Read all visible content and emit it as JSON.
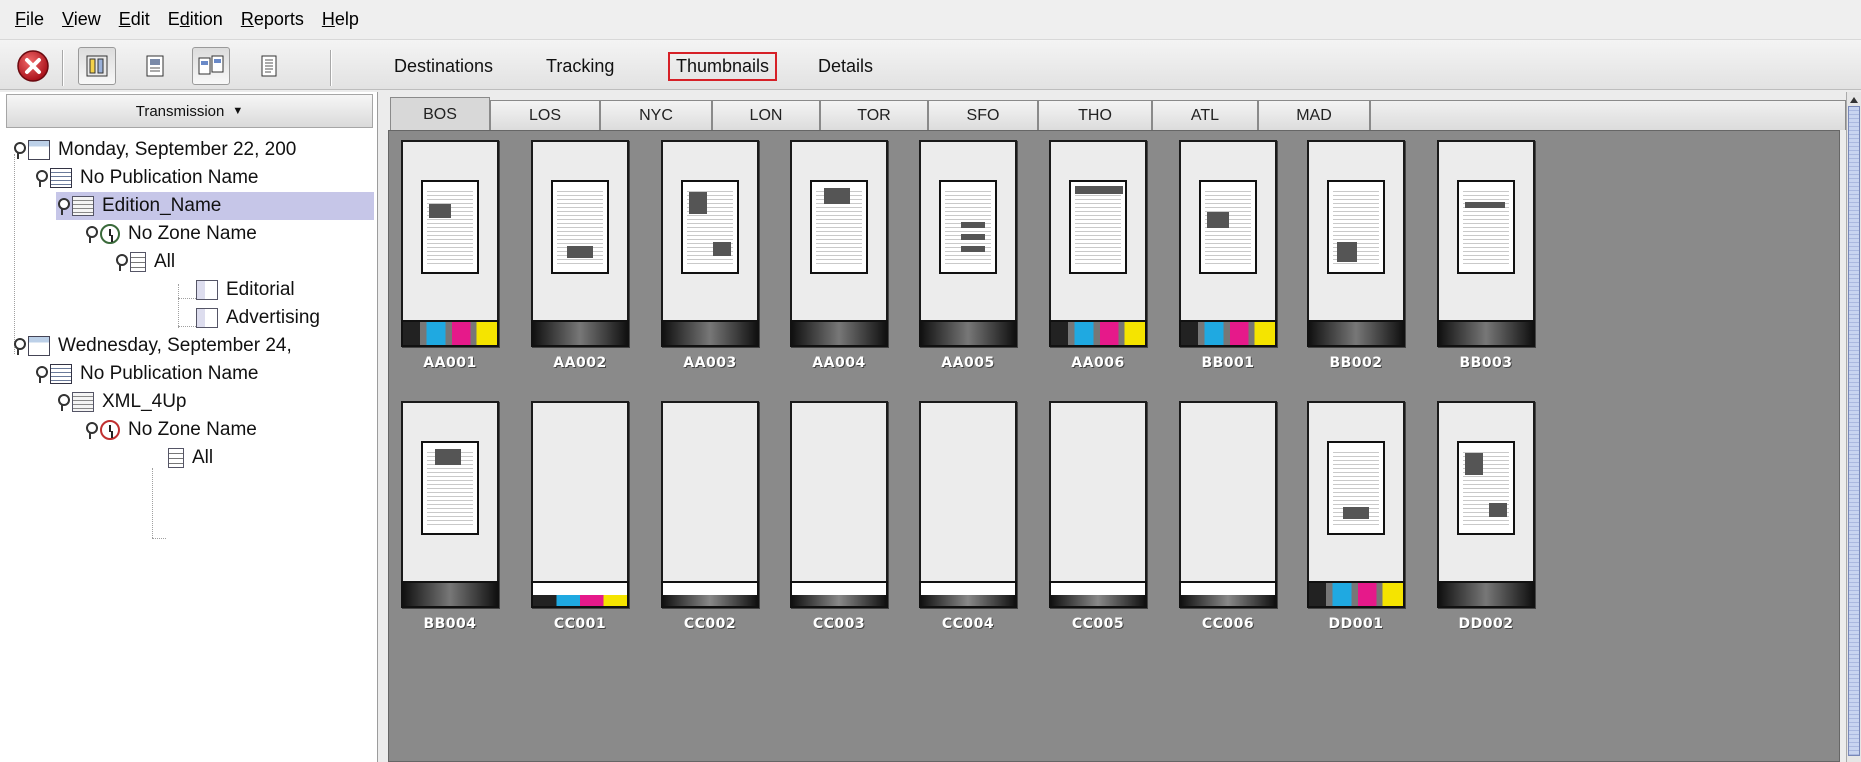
{
  "menu": {
    "items": [
      {
        "accel": "F",
        "rest": "ile"
      },
      {
        "accel": "V",
        "rest": "iew"
      },
      {
        "accel": "E",
        "rest": "dit"
      },
      {
        "accel": "",
        "rest": "Edition",
        "accel_index": 1
      },
      {
        "accel": "R",
        "rest": "eports"
      },
      {
        "accel": "H",
        "rest": "elp"
      }
    ]
  },
  "toolbar": {
    "views": [
      "Destinations",
      "Tracking",
      "Thumbnails",
      "Details"
    ],
    "active_view": "Thumbnails",
    "highlight_color": "#d62027"
  },
  "tree": {
    "header": "Transmission",
    "rows": [
      {
        "label": "Monday, September 22, 200",
        "icon": "calendar-icon"
      },
      {
        "label": "No Publication Name",
        "icon": "publication-icon"
      },
      {
        "label": "Edition_Name",
        "icon": "edition-icon",
        "selected": true
      },
      {
        "label": "No Zone Name",
        "icon": "clock-icon"
      },
      {
        "label": "All",
        "icon": "pages-icon"
      },
      {
        "label": "Editorial",
        "icon": "document-icon"
      },
      {
        "label": "Advertising",
        "icon": "document-icon"
      },
      {
        "label": "Wednesday, September 24,",
        "icon": "calendar-icon"
      },
      {
        "label": "No Publication Name",
        "icon": "publication-icon"
      },
      {
        "label": "XML_4Up",
        "icon": "edition-icon"
      },
      {
        "label": "No Zone Name",
        "icon": "clock-icon"
      },
      {
        "label": "All",
        "icon": "pages-icon"
      }
    ],
    "selected_color": "#c6c6e8"
  },
  "destination_tabs": {
    "tabs": [
      "BOS",
      "LOS",
      "NYC",
      "LON",
      "TOR",
      "SFO",
      "THO",
      "ATL",
      "MAD"
    ],
    "active": "BOS"
  },
  "thumbnails": {
    "row1": [
      {
        "label": "AA001",
        "bar": "cmyk",
        "has_page": true
      },
      {
        "label": "AA002",
        "bar": "black",
        "has_page": true
      },
      {
        "label": "AA003",
        "bar": "black",
        "has_page": true
      },
      {
        "label": "AA004",
        "bar": "black",
        "has_page": true
      },
      {
        "label": "AA005",
        "bar": "black",
        "has_page": true
      },
      {
        "label": "AA006",
        "bar": "cmyk",
        "has_page": true
      },
      {
        "label": "BB001",
        "bar": "cmyk",
        "has_page": true
      },
      {
        "label": "BB002",
        "bar": "black",
        "has_page": true
      },
      {
        "label": "BB003",
        "bar": "black",
        "has_page": true
      }
    ],
    "row2": [
      {
        "label": "BB004",
        "bar": "black",
        "has_page": true
      },
      {
        "label": "CC001",
        "bar": "cmyk-thin",
        "has_page": false
      },
      {
        "label": "CC002",
        "bar": "thin-black",
        "has_page": false
      },
      {
        "label": "CC003",
        "bar": "thin-black",
        "has_page": false
      },
      {
        "label": "CC004",
        "bar": "thin-black",
        "has_page": false
      },
      {
        "label": "CC005",
        "bar": "thin-black",
        "has_page": false
      },
      {
        "label": "CC006",
        "bar": "thin-black",
        "has_page": false
      },
      {
        "label": "DD001",
        "bar": "cmyk",
        "has_page": true
      },
      {
        "label": "DD002",
        "bar": "black",
        "has_page": true
      }
    ],
    "label_color": "#ffffff",
    "background": "#8a8a8a"
  },
  "colors": {
    "cyan": "#1fa9e1",
    "magenta": "#e6198a",
    "yellow": "#f5e400",
    "close_button": "#c8202a"
  }
}
